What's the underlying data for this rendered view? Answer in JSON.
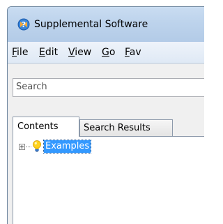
{
  "window": {
    "title": "Supplemental Software",
    "app_icon": "help-icon"
  },
  "menu": [
    {
      "accel": "F",
      "rest": "ile"
    },
    {
      "accel": "E",
      "rest": "dit"
    },
    {
      "accel": "V",
      "rest": "iew"
    },
    {
      "accel": "G",
      "rest": "o"
    },
    {
      "accel": "F",
      "rest": "av"
    }
  ],
  "search": {
    "placeholder": "Search",
    "value": ""
  },
  "tabs": [
    {
      "label": "Contents",
      "selected": true
    },
    {
      "label": "Search Results",
      "selected": false
    }
  ],
  "tree": {
    "items": [
      {
        "label": "Examples",
        "icon": "lightbulb-icon",
        "expanded": false,
        "selected": true
      }
    ]
  },
  "colors": {
    "selection": "#3399ff",
    "titlebar": "#bdd3ec"
  }
}
